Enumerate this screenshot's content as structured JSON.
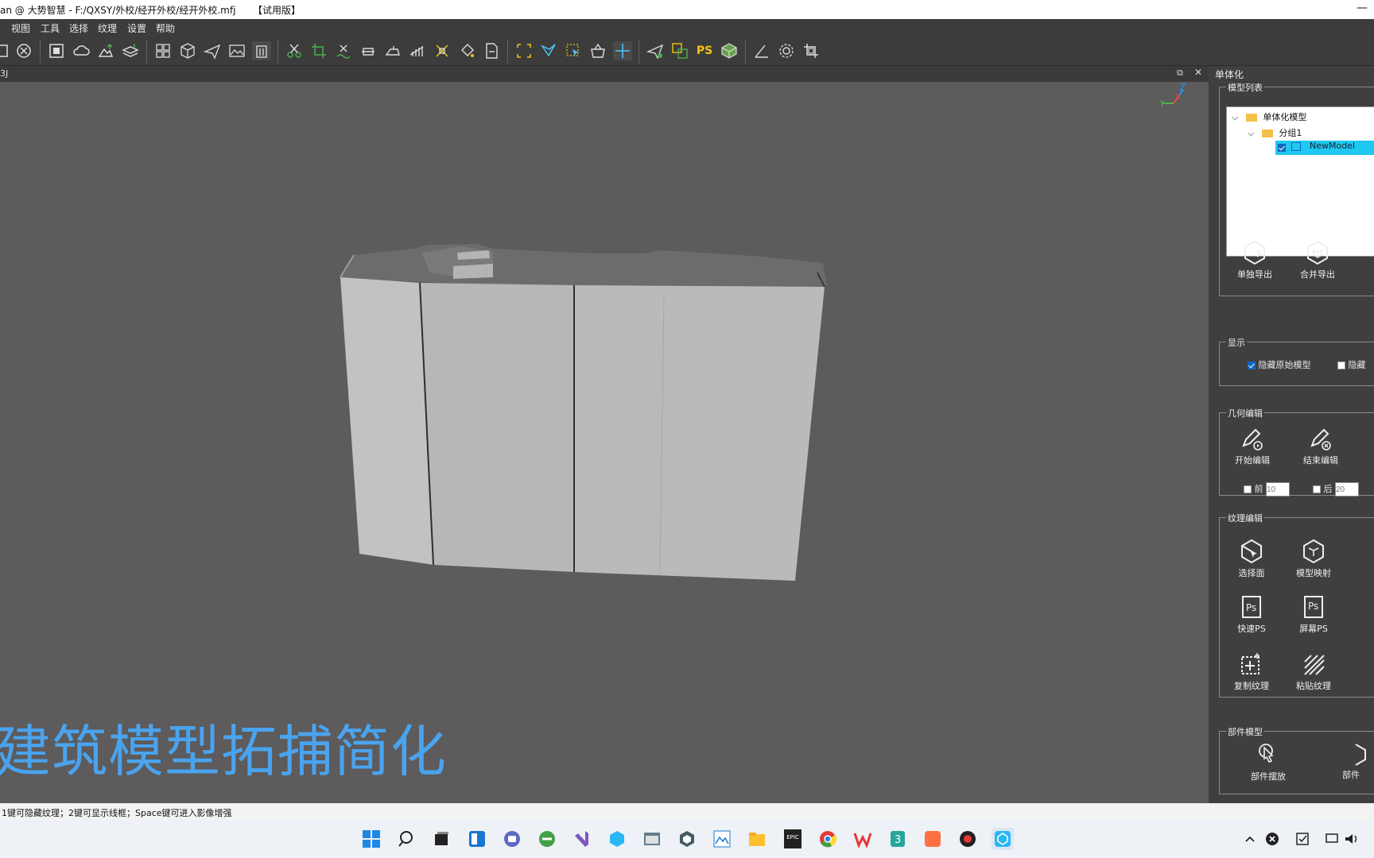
{
  "window": {
    "title": "an @ 大势智慧 - F:/QXSY/外校/经开外校/经开外校.mfj",
    "trial": "【试用版】",
    "minimize": "—"
  },
  "menu": [
    "视图",
    "工具",
    "选择",
    "纹理",
    "设置",
    "帮助"
  ],
  "viewport": {
    "tab_label": "3J",
    "overlay_title": "建筑模型拓捕简化",
    "axis_labels": {
      "z": "Z",
      "y": "Y",
      "x": "X"
    },
    "model_color": "#b7b7b7"
  },
  "panel": {
    "title": "单体化",
    "model_list": {
      "label": "模型列表",
      "root": "单体化模型",
      "group": "分组1",
      "item": "NewModel"
    },
    "export": {
      "single": "单独导出",
      "merge": "合并导出"
    },
    "display": {
      "label": "显示",
      "hide_original": "隐藏原始模型",
      "hide_original_checked": true,
      "hide_other": "隐藏",
      "hide_other_checked": false
    },
    "geometry": {
      "label": "几何编辑",
      "start": "开始编辑",
      "end": "结束编辑",
      "front_label": "前",
      "front_value": "10",
      "back_label": "后",
      "back_value": "20"
    },
    "texture": {
      "label": "纹理编辑",
      "select_face": "选择面",
      "model_map": "模型映射",
      "quick_ps": "快速PS",
      "screen_ps": "屏幕PS",
      "copy_texture": "复制纹理",
      "paste_texture": "粘贴纹理"
    },
    "parts": {
      "label": "部件模型",
      "place": "部件摆放",
      "other": "部件"
    }
  },
  "status": "1键可隐藏纹理；2键可显示线框；Space键可进入影像增强",
  "toolbar_ps": "PS",
  "accent": "#4aa3ee",
  "taskbar": {
    "epic": "EPIC"
  }
}
